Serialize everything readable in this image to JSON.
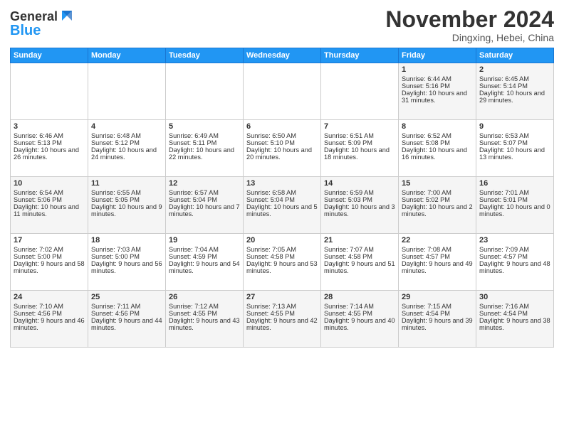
{
  "header": {
    "logo_line1": "General",
    "logo_line2": "Blue",
    "month": "November 2024",
    "location": "Dingxing, Hebei, China"
  },
  "days_of_week": [
    "Sunday",
    "Monday",
    "Tuesday",
    "Wednesday",
    "Thursday",
    "Friday",
    "Saturday"
  ],
  "weeks": [
    [
      {
        "day": "",
        "content": ""
      },
      {
        "day": "",
        "content": ""
      },
      {
        "day": "",
        "content": ""
      },
      {
        "day": "",
        "content": ""
      },
      {
        "day": "",
        "content": ""
      },
      {
        "day": "1",
        "content": "Sunrise: 6:44 AM\nSunset: 5:16 PM\nDaylight: 10 hours and 31 minutes."
      },
      {
        "day": "2",
        "content": "Sunrise: 6:45 AM\nSunset: 5:14 PM\nDaylight: 10 hours and 29 minutes."
      }
    ],
    [
      {
        "day": "3",
        "content": "Sunrise: 6:46 AM\nSunset: 5:13 PM\nDaylight: 10 hours and 26 minutes."
      },
      {
        "day": "4",
        "content": "Sunrise: 6:48 AM\nSunset: 5:12 PM\nDaylight: 10 hours and 24 minutes."
      },
      {
        "day": "5",
        "content": "Sunrise: 6:49 AM\nSunset: 5:11 PM\nDaylight: 10 hours and 22 minutes."
      },
      {
        "day": "6",
        "content": "Sunrise: 6:50 AM\nSunset: 5:10 PM\nDaylight: 10 hours and 20 minutes."
      },
      {
        "day": "7",
        "content": "Sunrise: 6:51 AM\nSunset: 5:09 PM\nDaylight: 10 hours and 18 minutes."
      },
      {
        "day": "8",
        "content": "Sunrise: 6:52 AM\nSunset: 5:08 PM\nDaylight: 10 hours and 16 minutes."
      },
      {
        "day": "9",
        "content": "Sunrise: 6:53 AM\nSunset: 5:07 PM\nDaylight: 10 hours and 13 minutes."
      }
    ],
    [
      {
        "day": "10",
        "content": "Sunrise: 6:54 AM\nSunset: 5:06 PM\nDaylight: 10 hours and 11 minutes."
      },
      {
        "day": "11",
        "content": "Sunrise: 6:55 AM\nSunset: 5:05 PM\nDaylight: 10 hours and 9 minutes."
      },
      {
        "day": "12",
        "content": "Sunrise: 6:57 AM\nSunset: 5:04 PM\nDaylight: 10 hours and 7 minutes."
      },
      {
        "day": "13",
        "content": "Sunrise: 6:58 AM\nSunset: 5:04 PM\nDaylight: 10 hours and 5 minutes."
      },
      {
        "day": "14",
        "content": "Sunrise: 6:59 AM\nSunset: 5:03 PM\nDaylight: 10 hours and 3 minutes."
      },
      {
        "day": "15",
        "content": "Sunrise: 7:00 AM\nSunset: 5:02 PM\nDaylight: 10 hours and 2 minutes."
      },
      {
        "day": "16",
        "content": "Sunrise: 7:01 AM\nSunset: 5:01 PM\nDaylight: 10 hours and 0 minutes."
      }
    ],
    [
      {
        "day": "17",
        "content": "Sunrise: 7:02 AM\nSunset: 5:00 PM\nDaylight: 9 hours and 58 minutes."
      },
      {
        "day": "18",
        "content": "Sunrise: 7:03 AM\nSunset: 5:00 PM\nDaylight: 9 hours and 56 minutes."
      },
      {
        "day": "19",
        "content": "Sunrise: 7:04 AM\nSunset: 4:59 PM\nDaylight: 9 hours and 54 minutes."
      },
      {
        "day": "20",
        "content": "Sunrise: 7:05 AM\nSunset: 4:58 PM\nDaylight: 9 hours and 53 minutes."
      },
      {
        "day": "21",
        "content": "Sunrise: 7:07 AM\nSunset: 4:58 PM\nDaylight: 9 hours and 51 minutes."
      },
      {
        "day": "22",
        "content": "Sunrise: 7:08 AM\nSunset: 4:57 PM\nDaylight: 9 hours and 49 minutes."
      },
      {
        "day": "23",
        "content": "Sunrise: 7:09 AM\nSunset: 4:57 PM\nDaylight: 9 hours and 48 minutes."
      }
    ],
    [
      {
        "day": "24",
        "content": "Sunrise: 7:10 AM\nSunset: 4:56 PM\nDaylight: 9 hours and 46 minutes."
      },
      {
        "day": "25",
        "content": "Sunrise: 7:11 AM\nSunset: 4:56 PM\nDaylight: 9 hours and 44 minutes."
      },
      {
        "day": "26",
        "content": "Sunrise: 7:12 AM\nSunset: 4:55 PM\nDaylight: 9 hours and 43 minutes."
      },
      {
        "day": "27",
        "content": "Sunrise: 7:13 AM\nSunset: 4:55 PM\nDaylight: 9 hours and 42 minutes."
      },
      {
        "day": "28",
        "content": "Sunrise: 7:14 AM\nSunset: 4:55 PM\nDaylight: 9 hours and 40 minutes."
      },
      {
        "day": "29",
        "content": "Sunrise: 7:15 AM\nSunset: 4:54 PM\nDaylight: 9 hours and 39 minutes."
      },
      {
        "day": "30",
        "content": "Sunrise: 7:16 AM\nSunset: 4:54 PM\nDaylight: 9 hours and 38 minutes."
      }
    ]
  ]
}
